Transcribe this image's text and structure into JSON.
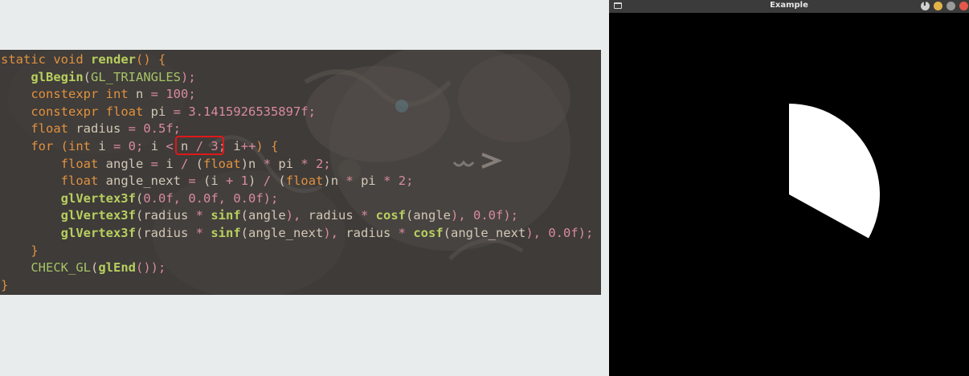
{
  "code_editor": {
    "lines": [
      [
        {
          "t": "static ",
          "c": "kw"
        },
        {
          "t": "void ",
          "c": "kw"
        },
        {
          "t": "render",
          "c": "fn"
        },
        {
          "t": "() {",
          "c": "brace"
        }
      ],
      [
        {
          "t": "    ",
          "c": "pl"
        },
        {
          "t": "glBegin",
          "c": "fn"
        },
        {
          "t": "(",
          "c": "pl"
        },
        {
          "t": "GL_TRIANGLES",
          "c": "mac"
        },
        {
          "t": ");",
          "c": "op"
        }
      ],
      [
        {
          "t": "    ",
          "c": "pl"
        },
        {
          "t": "constexpr ",
          "c": "kw"
        },
        {
          "t": "int ",
          "c": "ty"
        },
        {
          "t": "n ",
          "c": "pl"
        },
        {
          "t": "= ",
          "c": "op"
        },
        {
          "t": "100",
          "c": "num"
        },
        {
          "t": ";",
          "c": "op"
        }
      ],
      [
        {
          "t": "    ",
          "c": "pl"
        },
        {
          "t": "constexpr ",
          "c": "kw"
        },
        {
          "t": "float ",
          "c": "ty"
        },
        {
          "t": "pi ",
          "c": "pl"
        },
        {
          "t": "= ",
          "c": "op"
        },
        {
          "t": "3.1415926535897f",
          "c": "num"
        },
        {
          "t": ";",
          "c": "op"
        }
      ],
      [
        {
          "t": "    ",
          "c": "pl"
        },
        {
          "t": "float ",
          "c": "ty"
        },
        {
          "t": "radius ",
          "c": "pl"
        },
        {
          "t": "= ",
          "c": "op"
        },
        {
          "t": "0.5f",
          "c": "num"
        },
        {
          "t": ";",
          "c": "op"
        }
      ],
      [
        {
          "t": "    ",
          "c": "pl"
        },
        {
          "t": "for ",
          "c": "kw"
        },
        {
          "t": "(",
          "c": "brace"
        },
        {
          "t": "int ",
          "c": "ty"
        },
        {
          "t": "i ",
          "c": "pl"
        },
        {
          "t": "= ",
          "c": "op"
        },
        {
          "t": "0",
          "c": "num"
        },
        {
          "t": "; ",
          "c": "op"
        },
        {
          "t": "i ",
          "c": "pl"
        },
        {
          "t": "< ",
          "c": "op"
        },
        {
          "t": "n ",
          "c": "pl"
        },
        {
          "t": "/ ",
          "c": "op"
        },
        {
          "t": "3",
          "c": "num"
        },
        {
          "t": "; ",
          "c": "op"
        },
        {
          "t": "i",
          "c": "pl"
        },
        {
          "t": "++",
          "c": "op"
        },
        {
          "t": ") {",
          "c": "brace"
        }
      ],
      [
        {
          "t": "        ",
          "c": "pl"
        },
        {
          "t": "float ",
          "c": "ty"
        },
        {
          "t": "angle ",
          "c": "pl"
        },
        {
          "t": "= ",
          "c": "op"
        },
        {
          "t": "i ",
          "c": "pl"
        },
        {
          "t": "/ ",
          "c": "op"
        },
        {
          "t": "(",
          "c": "pl"
        },
        {
          "t": "float",
          "c": "ty"
        },
        {
          "t": ")",
          "c": "pl"
        },
        {
          "t": "n ",
          "c": "pl"
        },
        {
          "t": "* ",
          "c": "op"
        },
        {
          "t": "pi ",
          "c": "pl"
        },
        {
          "t": "* ",
          "c": "op"
        },
        {
          "t": "2",
          "c": "num"
        },
        {
          "t": ";",
          "c": "op"
        }
      ],
      [
        {
          "t": "        ",
          "c": "pl"
        },
        {
          "t": "float ",
          "c": "ty"
        },
        {
          "t": "angle_next ",
          "c": "pl"
        },
        {
          "t": "= ",
          "c": "op"
        },
        {
          "t": "(",
          "c": "pl"
        },
        {
          "t": "i ",
          "c": "pl"
        },
        {
          "t": "+ ",
          "c": "op"
        },
        {
          "t": "1",
          "c": "num"
        },
        {
          "t": ") ",
          "c": "pl"
        },
        {
          "t": "/ ",
          "c": "op"
        },
        {
          "t": "(",
          "c": "pl"
        },
        {
          "t": "float",
          "c": "ty"
        },
        {
          "t": ")",
          "c": "pl"
        },
        {
          "t": "n ",
          "c": "pl"
        },
        {
          "t": "* ",
          "c": "op"
        },
        {
          "t": "pi ",
          "c": "pl"
        },
        {
          "t": "* ",
          "c": "op"
        },
        {
          "t": "2",
          "c": "num"
        },
        {
          "t": ";",
          "c": "op"
        }
      ],
      [
        {
          "t": "        ",
          "c": "pl"
        },
        {
          "t": "glVertex3f",
          "c": "fn"
        },
        {
          "t": "(",
          "c": "pl"
        },
        {
          "t": "0.0f",
          "c": "num"
        },
        {
          "t": ", ",
          "c": "op"
        },
        {
          "t": "0.0f",
          "c": "num"
        },
        {
          "t": ", ",
          "c": "op"
        },
        {
          "t": "0.0f",
          "c": "num"
        },
        {
          "t": ");",
          "c": "op"
        }
      ],
      [
        {
          "t": "        ",
          "c": "pl"
        },
        {
          "t": "glVertex3f",
          "c": "fn"
        },
        {
          "t": "(",
          "c": "pl"
        },
        {
          "t": "radius ",
          "c": "pl"
        },
        {
          "t": "* ",
          "c": "op"
        },
        {
          "t": "sinf",
          "c": "fn"
        },
        {
          "t": "(",
          "c": "pl"
        },
        {
          "t": "angle",
          "c": "pl"
        },
        {
          "t": "), ",
          "c": "op"
        },
        {
          "t": "radius ",
          "c": "pl"
        },
        {
          "t": "* ",
          "c": "op"
        },
        {
          "t": "cosf",
          "c": "fn"
        },
        {
          "t": "(",
          "c": "pl"
        },
        {
          "t": "angle",
          "c": "pl"
        },
        {
          "t": "), ",
          "c": "op"
        },
        {
          "t": "0.0f",
          "c": "num"
        },
        {
          "t": ");",
          "c": "op"
        }
      ],
      [
        {
          "t": "        ",
          "c": "pl"
        },
        {
          "t": "glVertex3f",
          "c": "fn"
        },
        {
          "t": "(",
          "c": "pl"
        },
        {
          "t": "radius ",
          "c": "pl"
        },
        {
          "t": "* ",
          "c": "op"
        },
        {
          "t": "sinf",
          "c": "fn"
        },
        {
          "t": "(",
          "c": "pl"
        },
        {
          "t": "angle_next",
          "c": "pl"
        },
        {
          "t": "), ",
          "c": "op"
        },
        {
          "t": "radius ",
          "c": "pl"
        },
        {
          "t": "* ",
          "c": "op"
        },
        {
          "t": "cosf",
          "c": "fn"
        },
        {
          "t": "(",
          "c": "pl"
        },
        {
          "t": "angle_next",
          "c": "pl"
        },
        {
          "t": "), ",
          "c": "op"
        },
        {
          "t": "0.0f",
          "c": "num"
        },
        {
          "t": ");",
          "c": "op"
        }
      ],
      [
        {
          "t": "    }",
          "c": "brace"
        }
      ],
      [
        {
          "t": "    ",
          "c": "pl"
        },
        {
          "t": "CHECK_GL",
          "c": "mac"
        },
        {
          "t": "(",
          "c": "pl"
        },
        {
          "t": "glEnd",
          "c": "fn"
        },
        {
          "t": "());",
          "c": "op"
        }
      ],
      [
        {
          "t": "}",
          "c": "brace"
        }
      ]
    ],
    "highlight_color": "#e01818"
  },
  "window": {
    "title": "Example",
    "buttons": [
      "up-icon",
      "minimize-icon",
      "maximize-icon",
      "close-icon"
    ],
    "background": "#000000",
    "rendered_shape": {
      "type": "circle-sector",
      "fill": "#ffffff",
      "sweep_fraction": 0.33,
      "start_angle_deg": 0
    }
  }
}
